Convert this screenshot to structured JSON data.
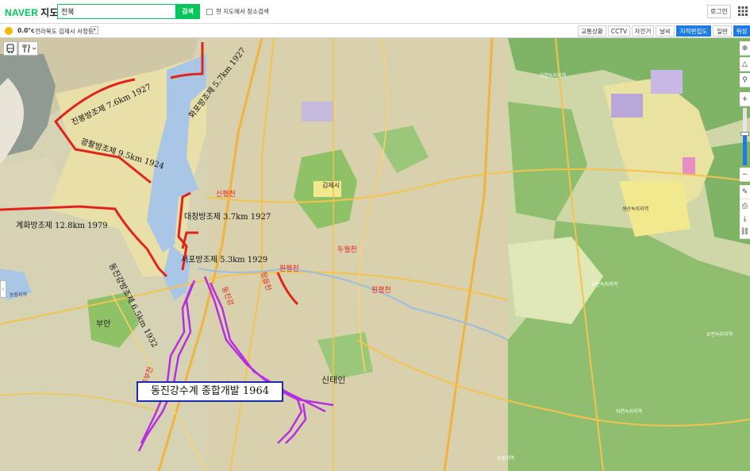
{
  "header": {
    "logo_brand": "NAVER",
    "logo_product": "지도",
    "search_value": "전북",
    "search_button": "검색",
    "nearby_checkbox_label": "현 지도에서 장소검색",
    "login_button": "로그인"
  },
  "subbar": {
    "temperature": "0.0°c",
    "location": "전라북도 김제시 서정동",
    "map_types": [
      "교통상황",
      "CCTV",
      "자전거",
      "날씨",
      "지적편집도",
      "일반",
      "위성"
    ],
    "active_map_type": "지적편집도",
    "satellite_active": "위성"
  },
  "map": {
    "annotations": [
      "진봉방조제 7.6km 1927",
      "화포방조제 5.7km 1927",
      "광활방조제 9.5km 1924",
      "계화방조제 12.8km 1979",
      "대창방조제 3.7km 1927",
      "서포방조제 5.3km 1929",
      "동진강방조제 6.5km 1932"
    ],
    "rivers": [
      "신평천",
      "원평천",
      "두월천",
      "원평천",
      "동진강",
      "고부천",
      "정읍천"
    ],
    "towns": [
      "김제시",
      "부안",
      "신태인"
    ],
    "box_label": "동진강수계 종합개발 1964",
    "minor_labels": [
      "자연녹지지역",
      "보전녹지지역",
      "자연녹지지역",
      "농림지역",
      "농림지역",
      "생산녹지지역",
      "보전녹지지역"
    ]
  },
  "colors": {
    "naver_green": "#03c75a",
    "active_blue": "#1e7be0",
    "dike_red": "#e2231a",
    "river_purple": "#b52ee0",
    "box_border": "#1a2bb0"
  }
}
